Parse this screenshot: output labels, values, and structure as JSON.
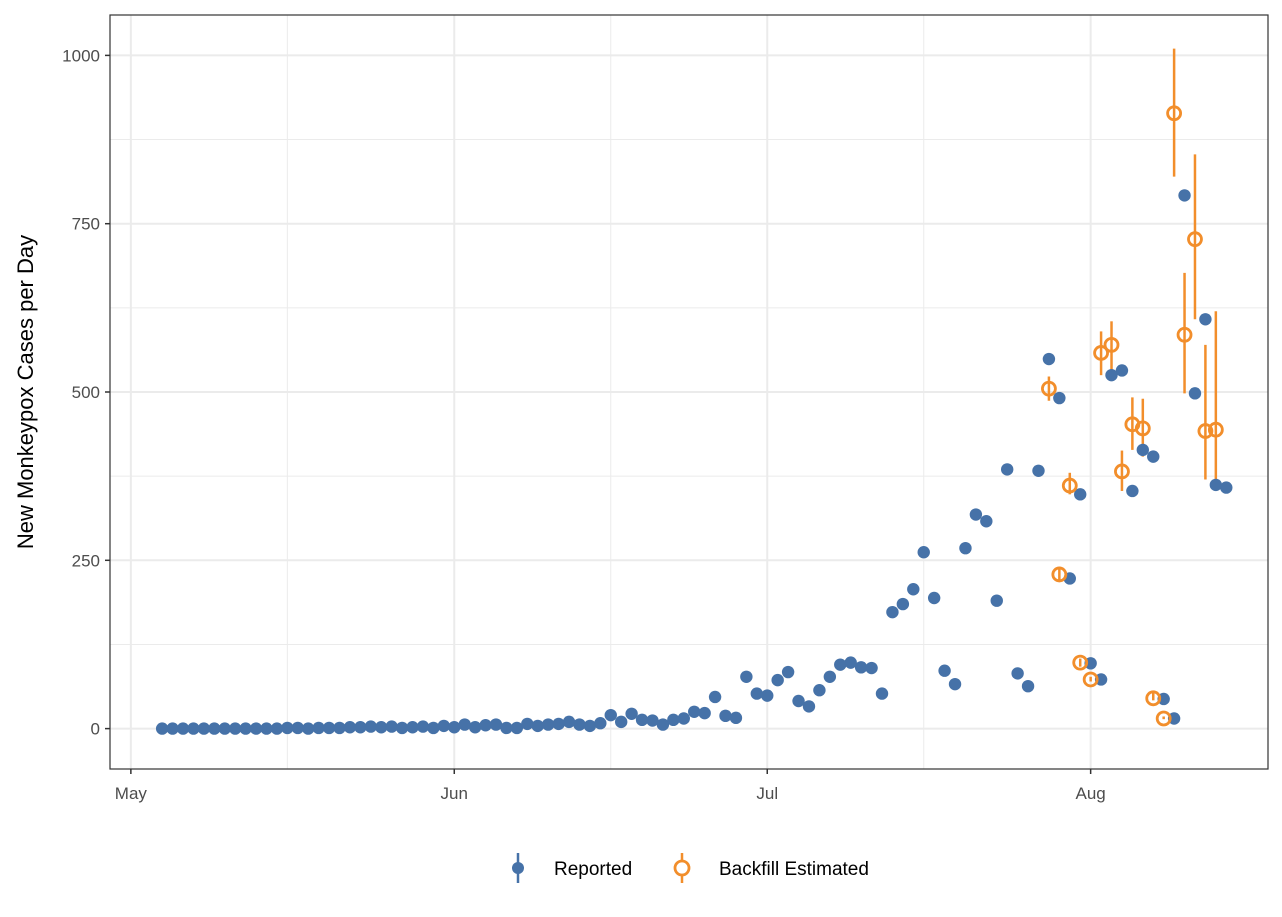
{
  "chart_data": {
    "type": "scatter",
    "title": "",
    "xlabel": "",
    "ylabel": "New Monkeypox Cases per Day",
    "x_type": "date",
    "year": 2022,
    "xlim": [
      "2022-04-29",
      "2022-08-18"
    ],
    "ylim": [
      -60,
      1060
    ],
    "y_ticks": [
      0,
      250,
      500,
      750,
      1000
    ],
    "y_minor_ticks": [
      125,
      375,
      625,
      875
    ],
    "x_ticks": [
      {
        "date": "2022-05-01",
        "label": "May"
      },
      {
        "date": "2022-06-01",
        "label": "Jun"
      },
      {
        "date": "2022-07-01",
        "label": "Jul"
      },
      {
        "date": "2022-08-01",
        "label": "Aug"
      }
    ],
    "x_minor_ticks": [
      "2022-05-16",
      "2022-06-16",
      "2022-07-16"
    ],
    "grid": true,
    "legend": {
      "position": "bottom",
      "entries": [
        {
          "name": "Reported",
          "color": "#4672a8",
          "shape": "filled-circle-with-errorbar"
        },
        {
          "name": "Backfill Estimated",
          "color": "#f28e2b",
          "shape": "open-circle-with-errorbar"
        }
      ]
    },
    "series": [
      {
        "name": "Reported",
        "color": "#4672a8",
        "start_date": "2022-05-04",
        "values": [
          0,
          0,
          0,
          0,
          0,
          0,
          0,
          0,
          0,
          0,
          0,
          0,
          1,
          1,
          0,
          1,
          1,
          1,
          2,
          2,
          3,
          2,
          3,
          1,
          2,
          3,
          1,
          4,
          2,
          6,
          2,
          5,
          6,
          1,
          1,
          7,
          4,
          6,
          7,
          10,
          6,
          4,
          8,
          20,
          10,
          22,
          13,
          12,
          6,
          13,
          15,
          25,
          23,
          47,
          19,
          16,
          77,
          52,
          49,
          72,
          84,
          41,
          33,
          57,
          77,
          95,
          98,
          91,
          90,
          52,
          173,
          185,
          207,
          262,
          194,
          86,
          66,
          268,
          318,
          308,
          190,
          385,
          82,
          63,
          383,
          549,
          491,
          223,
          348,
          97,
          73,
          525,
          532,
          353,
          414,
          404,
          44,
          15,
          792,
          498,
          608,
          362,
          358
        ]
      },
      {
        "name": "Backfill Estimated",
        "color": "#f28e2b",
        "points": [
          {
            "date": "2022-07-28",
            "value": 505,
            "lower": 487,
            "upper": 523
          },
          {
            "date": "2022-07-29",
            "value": 229,
            "lower": 220,
            "upper": 238
          },
          {
            "date": "2022-07-30",
            "value": 361,
            "lower": 348,
            "upper": 380
          },
          {
            "date": "2022-07-31",
            "value": 98,
            "lower": 92,
            "upper": 104
          },
          {
            "date": "2022-08-01",
            "value": 73,
            "lower": 70,
            "upper": 77
          },
          {
            "date": "2022-08-02",
            "value": 558,
            "lower": 525,
            "upper": 590
          },
          {
            "date": "2022-08-03",
            "value": 570,
            "lower": 532,
            "upper": 605
          },
          {
            "date": "2022-08-04",
            "value": 382,
            "lower": 353,
            "upper": 413
          },
          {
            "date": "2022-08-05",
            "value": 452,
            "lower": 414,
            "upper": 492
          },
          {
            "date": "2022-08-06",
            "value": 446,
            "lower": 404,
            "upper": 490
          },
          {
            "date": "2022-08-07",
            "value": 45,
            "lower": 42,
            "upper": 53
          },
          {
            "date": "2022-08-08",
            "value": 15,
            "lower": 14,
            "upper": 18
          },
          {
            "date": "2022-08-09",
            "value": 914,
            "lower": 820,
            "upper": 1010
          },
          {
            "date": "2022-08-10",
            "value": 585,
            "lower": 498,
            "upper": 677
          },
          {
            "date": "2022-08-11",
            "value": 727,
            "lower": 608,
            "upper": 853
          },
          {
            "date": "2022-08-12",
            "value": 442,
            "lower": 370,
            "upper": 570
          },
          {
            "date": "2022-08-13",
            "value": 444,
            "lower": 358,
            "upper": 620
          }
        ]
      }
    ]
  }
}
